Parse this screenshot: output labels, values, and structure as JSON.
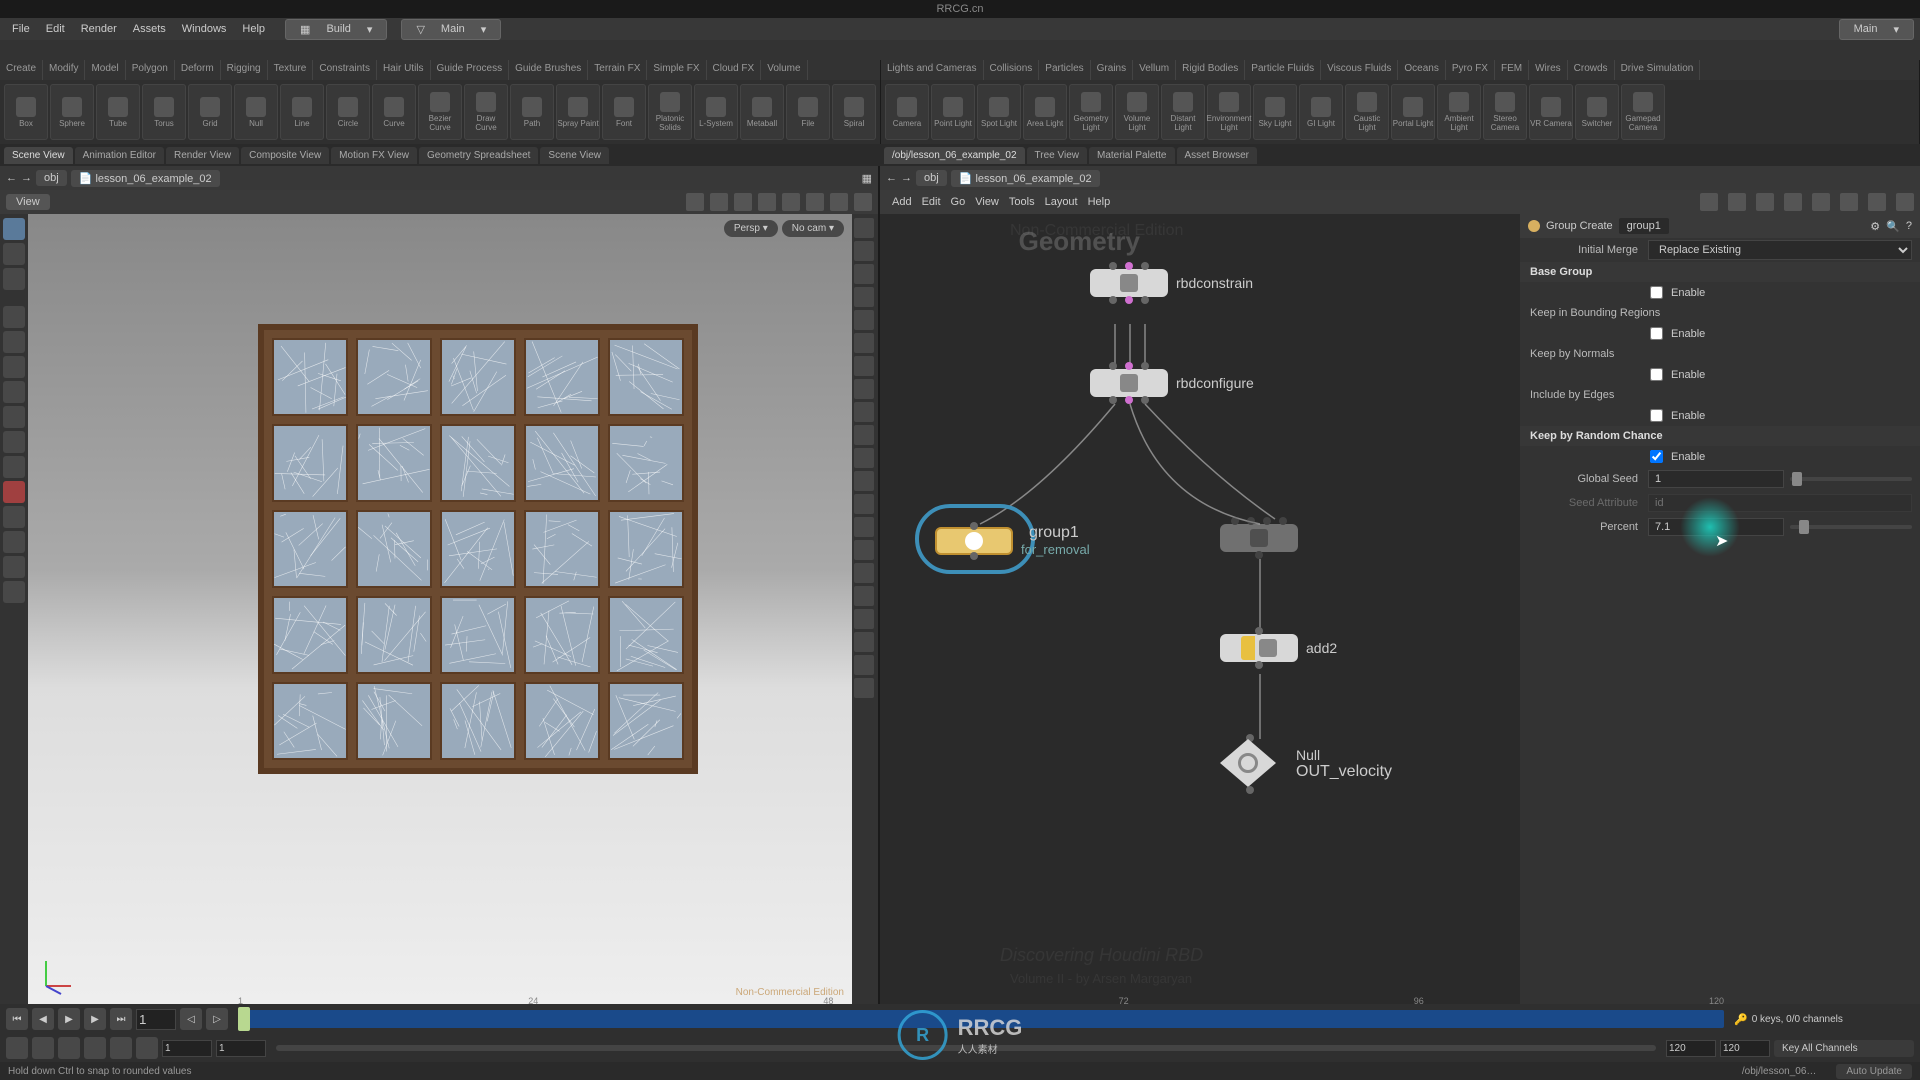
{
  "title": "RRCG.cn",
  "menus": {
    "file": "File",
    "edit": "Edit",
    "render": "Render",
    "assets": "Assets",
    "windows": "Windows",
    "help": "Help"
  },
  "desktop_sel": "Build",
  "menuset_sel": "Main",
  "right_sel": "Main",
  "shelf1_tabs": [
    "Create",
    "Modify",
    "Model",
    "Polygon",
    "Deform",
    "Rigging",
    "Texture",
    "Constraints",
    "Hair Utils",
    "Guide Process",
    "Guide Brushes",
    "Terrain FX",
    "Simple FX",
    "Cloud FX",
    "Volume"
  ],
  "shelf1_tools": [
    "Box",
    "Sphere",
    "Tube",
    "Torus",
    "Grid",
    "Null",
    "Line",
    "Circle",
    "Curve",
    "Bezier Curve",
    "Draw Curve",
    "Path",
    "Spray Paint",
    "Font",
    "Platonic Solids",
    "L-System",
    "Metaball",
    "File",
    "Spiral"
  ],
  "shelf2_tabs": [
    "Lights and Cameras",
    "Collisions",
    "Particles",
    "Grains",
    "Vellum",
    "Rigid Bodies",
    "Particle Fluids",
    "Viscous Fluids",
    "Oceans",
    "Pyro FX",
    "FEM",
    "Wires",
    "Crowds",
    "Drive Simulation"
  ],
  "shelf2_tools": [
    "Camera",
    "Point Light",
    "Spot Light",
    "Area Light",
    "Geometry Light",
    "Volume Light",
    "Distant Light",
    "Environment Light",
    "Sky Light",
    "GI Light",
    "Caustic Light",
    "Portal Light",
    "Ambient Light",
    "Stereo Camera",
    "VR Camera",
    "Switcher",
    "Gamepad Camera"
  ],
  "pane_tabs_left": [
    "Scene View",
    "Animation Editor",
    "Render View",
    "Composite View",
    "Motion FX View",
    "Geometry Spreadsheet",
    "Scene View"
  ],
  "pane_tabs_right": [
    "/obj/lesson_06_example_02",
    "Tree View",
    "Material Palette",
    "Asset Browser"
  ],
  "path_left": {
    "root": "obj",
    "file": "lesson_06_example_02"
  },
  "path_right": {
    "root": "obj",
    "file": "lesson_06_example_02"
  },
  "view_btn": "View",
  "camera": {
    "persp": "Persp ▾",
    "nocam": "No cam ▾"
  },
  "nc_label": "Non-Commercial Edition",
  "node_menu": {
    "add": "Add",
    "edit": "Edit",
    "go": "Go",
    "view": "View",
    "tools": "Tools",
    "layout": "Layout",
    "help": "Help"
  },
  "geometry_label": "Geometry",
  "nodes": {
    "rbdconstraint": "rbdconstrain",
    "rbdconfigure": "rbdconfigure",
    "group1": "group1",
    "for_removal": "for_removal",
    "add2": "add2",
    "null": "Null",
    "out_velocity": "OUT_velocity"
  },
  "wm1": "Non-Commercial Edition",
  "wm2": "Discovering Houdini RBD",
  "wm3": "Volume II - by Arsen Margaryan",
  "param": {
    "header_type": "Group Create",
    "header_name": "group1",
    "initial_merge": "Initial Merge",
    "initial_merge_val": "Replace Existing",
    "base_group": "Base Group",
    "enable": "Enable",
    "keep_bounding": "Keep in Bounding Regions",
    "keep_normals": "Keep by Normals",
    "include_edges": "Include by Edges",
    "keep_random": "Keep by Random Chance",
    "global_seed": "Global Seed",
    "global_seed_val": "1",
    "seed_attr": "Seed Attribute",
    "seed_attr_val": "id",
    "percent": "Percent",
    "percent_val": "7.1"
  },
  "timeline": {
    "frame": "1",
    "start": "1",
    "range_start": "1",
    "end1": "120",
    "end2": "120",
    "keys": "0 keys, 0/0 channels",
    "key_all": "Key All Channels",
    "auto": "Auto Update",
    "ticks": [
      "1",
      "24",
      "48",
      "72",
      "96",
      "120"
    ]
  },
  "status": "Hold down Ctrl to snap to rounded values",
  "status_right": "/obj/lesson_06…"
}
